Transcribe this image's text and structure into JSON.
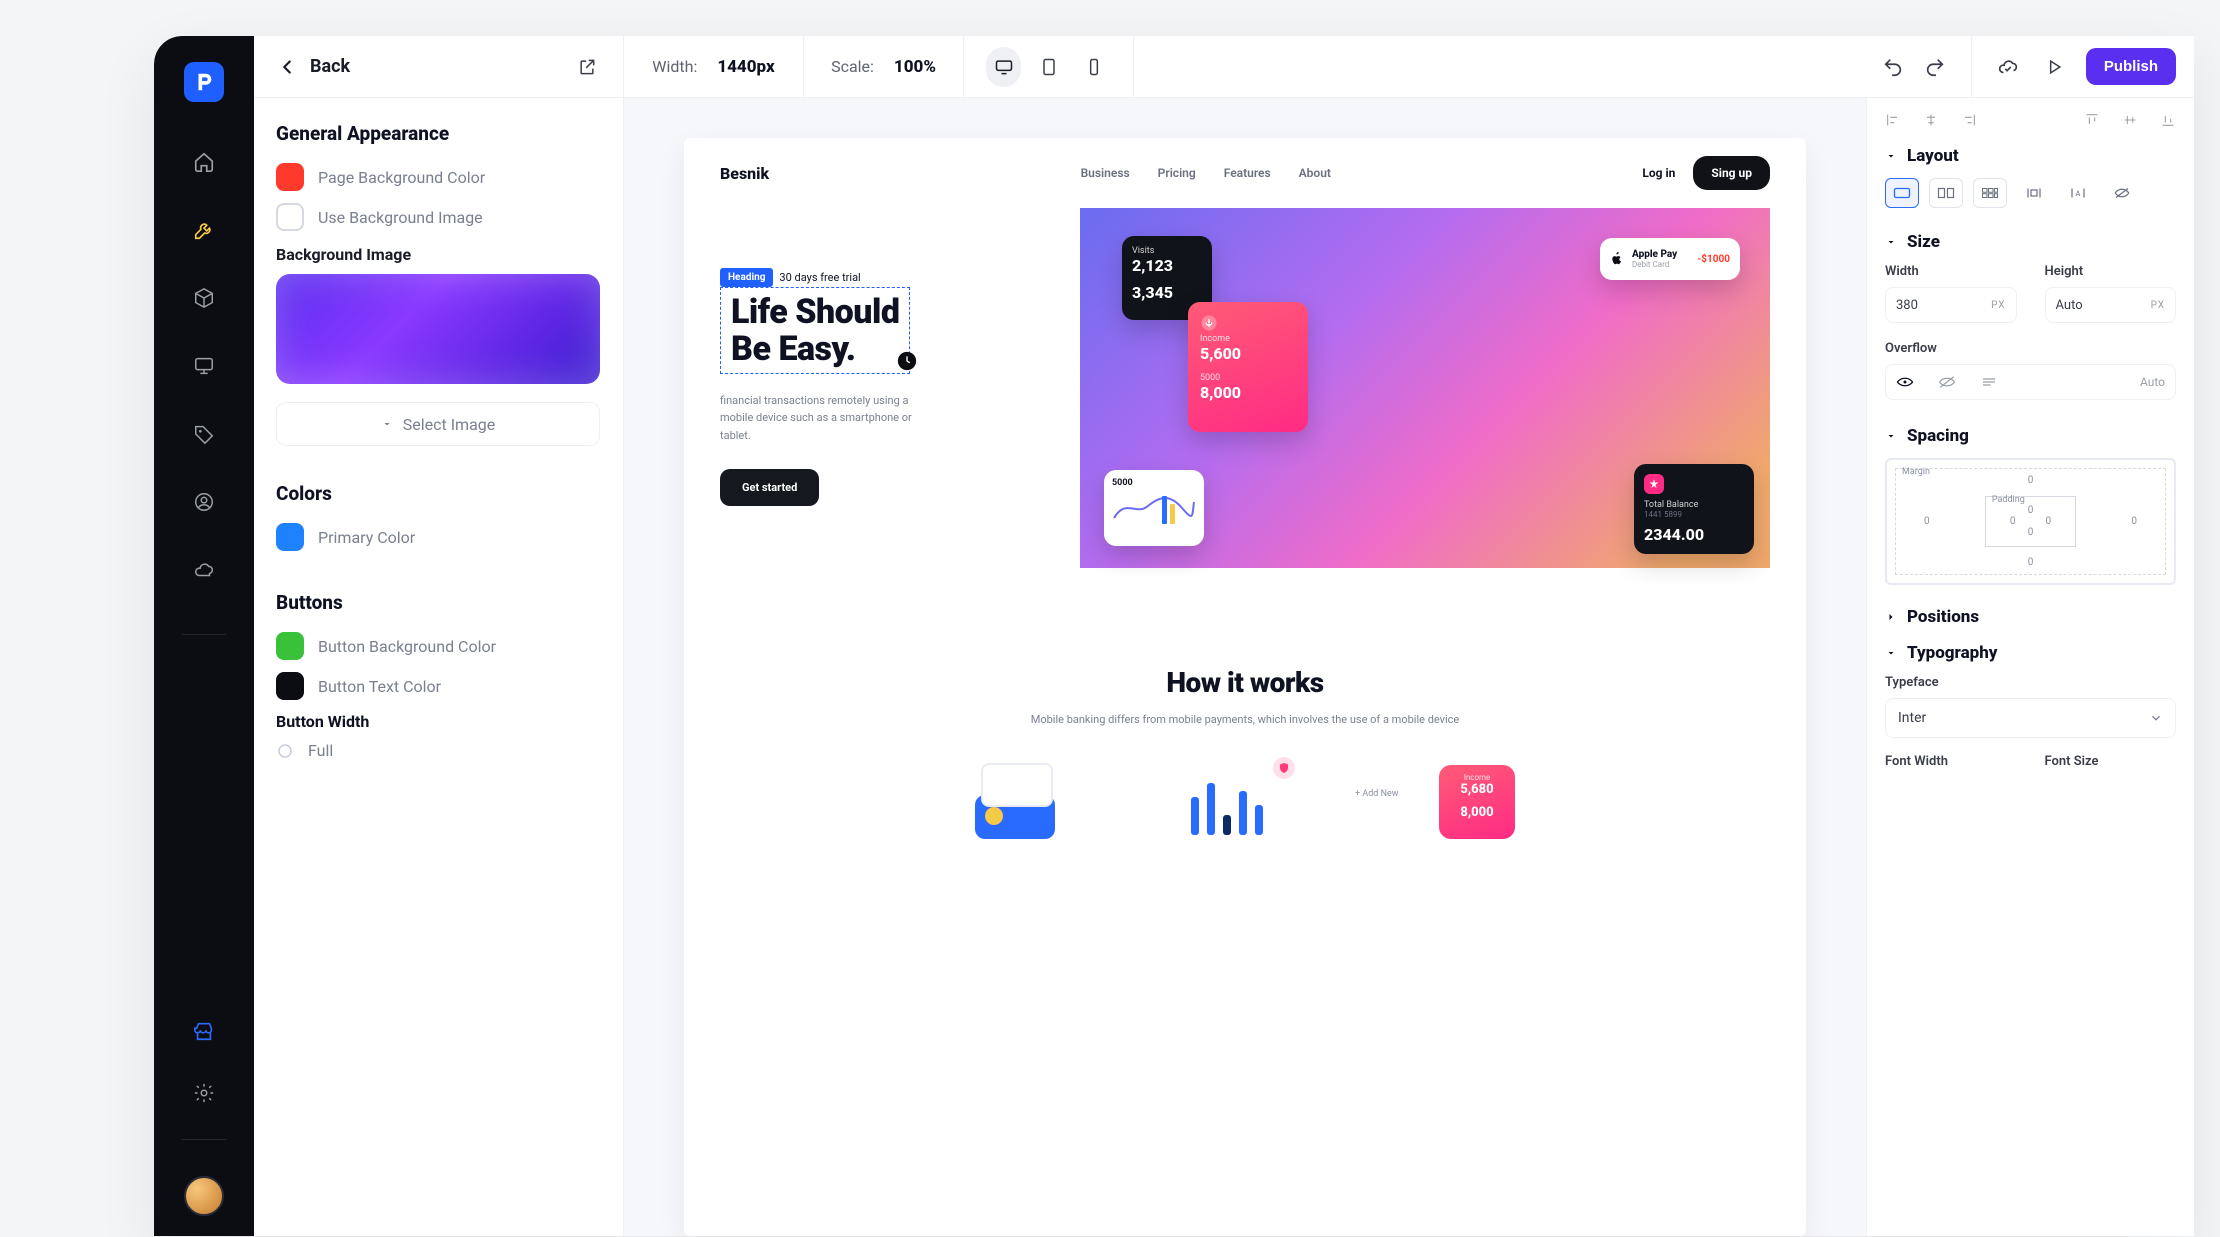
{
  "topbar": {
    "back_label": "Back",
    "width_label": "Width:",
    "width_value": "1440px",
    "scale_label": "Scale:",
    "scale_value": "100%",
    "publish_label": "Publish"
  },
  "left_panel": {
    "general_title": "General Appearance",
    "page_bg_color_label": "Page Background Color",
    "use_bg_image_label": "Use Background Image",
    "bg_image_title": "Background Image",
    "select_image_label": "Select Image",
    "colors_title": "Colors",
    "primary_color_label": "Primary Color",
    "buttons_title": "Buttons",
    "button_bg_color_label": "Button Background Color",
    "button_text_color_label": "Button Text Color",
    "button_width_title": "Button Width",
    "button_width_full": "Full"
  },
  "canvas": {
    "brand": "Besnik",
    "menu": [
      "Business",
      "Pricing",
      "Features",
      "About"
    ],
    "login": "Log in",
    "signup": "Sing up",
    "trial": "30 days free trial",
    "heading_tag": "Heading",
    "headline_l1": "Life Should",
    "headline_l2": "Be Easy.",
    "desc": "financial transactions remotely using a mobile device such as a smartphone or tablet.",
    "cta": "Get started",
    "cards": {
      "visits": {
        "label": "Visits",
        "value": "2,123"
      },
      "three": {
        "value": "3,345"
      },
      "income": {
        "label": "Income",
        "value": "5,600"
      },
      "five": {
        "value": "5000"
      },
      "eight": {
        "value": "8,000"
      },
      "stat": {
        "value": "5000"
      },
      "applepay": {
        "title": "Apple Pay",
        "sub": "Debit Card",
        "amount": "-$1000"
      },
      "balance": {
        "label": "Total Balance",
        "sub": "1441 5899",
        "value": "2344.00"
      }
    },
    "how_title": "How it works",
    "how_desc": "Mobile banking differs from mobile payments, which involves the use of a mobile device",
    "how_card": {
      "label": "Income",
      "value": "5,680",
      "value2": "8,000",
      "add": "+ Add New"
    }
  },
  "inspector": {
    "layout_title": "Layout",
    "size_title": "Size",
    "width_label": "Width",
    "height_label": "Height",
    "width_value": "380",
    "height_value": "Auto",
    "unit_px": "PX",
    "overflow_label": "Overflow",
    "overflow_auto": "Auto",
    "spacing_title": "Spacing",
    "margin_label": "Margin",
    "padding_label": "Padding",
    "bm_zero": "0",
    "positions_title": "Positions",
    "typography_title": "Typography",
    "typeface_label": "Typeface",
    "typeface_value": "Inter",
    "font_width_label": "Font Width",
    "font_size_label": "Font Size"
  }
}
